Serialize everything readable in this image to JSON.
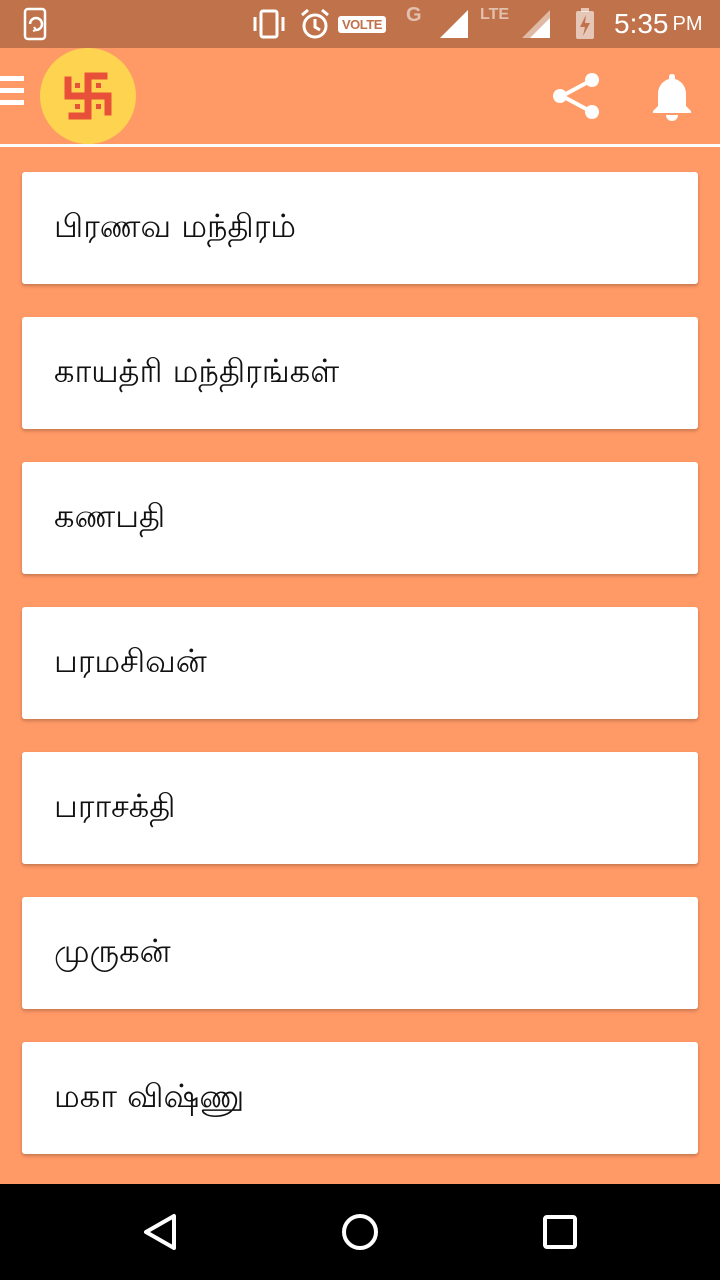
{
  "status_bar": {
    "volte": "VOLTE",
    "network_g": "G",
    "network_lte": "LTE",
    "time": "5:35",
    "ampm": "PM"
  },
  "app_bar": {
    "logo_icon": "swastika-icon",
    "menu_icon": "hamburger-menu-icon",
    "share_icon": "share-icon",
    "notification_icon": "bell-icon"
  },
  "menu_items": [
    {
      "label": "பிரணவ மந்திரம்"
    },
    {
      "label": "காயத்ரி மந்திரங்கள்"
    },
    {
      "label": "கணபதி"
    },
    {
      "label": "பரமசிவன்"
    },
    {
      "label": "பராசக்தி"
    },
    {
      "label": "முருகன்"
    },
    {
      "label": "மகா விஷ்ணு"
    }
  ],
  "colors": {
    "status_bar": "#C0724A",
    "background": "#FF9966",
    "logo_bg": "#FDD34F",
    "logo_symbol": "#E8503A",
    "card": "#FFFFFF"
  }
}
